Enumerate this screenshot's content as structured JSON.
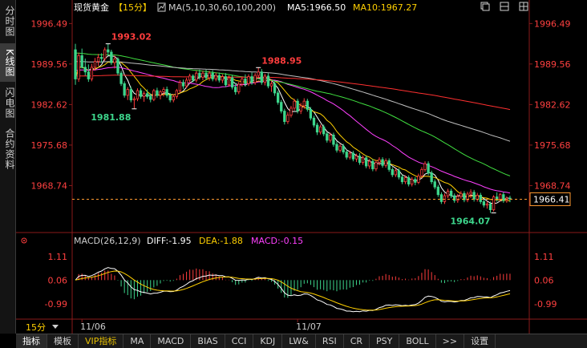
{
  "sidebar": {
    "tabs": [
      {
        "label": "分时图",
        "active": false
      },
      {
        "label": "K线图",
        "active": true
      },
      {
        "label": "闪电图",
        "active": false
      },
      {
        "label": "合约资料",
        "active": false
      }
    ]
  },
  "header": {
    "title": "现货黄金",
    "period": "【15分】",
    "ma_label": "MA(5,10,30,60,100,200)",
    "ma5": "MA5:1966.50",
    "ma10": "MA10:1967.27"
  },
  "macd_header": {
    "label": "MACD(26,12,9)",
    "diff": "DIFF:-1.95",
    "dea": "DEA:-1.88",
    "macd": "MACD:-0.15"
  },
  "period_select": "15分",
  "bottom_tabs": [
    {
      "label": "指标",
      "active": true,
      "vip": false
    },
    {
      "label": "模板",
      "active": false,
      "vip": false
    },
    {
      "label": "VIP指标",
      "active": false,
      "vip": true
    },
    {
      "label": "MA",
      "active": false,
      "vip": false
    },
    {
      "label": "MACD",
      "active": false,
      "vip": false
    },
    {
      "label": "BIAS",
      "active": false,
      "vip": false
    },
    {
      "label": "CCI",
      "active": false,
      "vip": false
    },
    {
      "label": "KDJ",
      "active": false,
      "vip": false
    },
    {
      "label": "LW&",
      "active": false,
      "vip": false
    },
    {
      "label": "RSI",
      "active": false,
      "vip": false
    },
    {
      "label": "CR",
      "active": false,
      "vip": false
    },
    {
      "label": "PSY",
      "active": false,
      "vip": false
    },
    {
      "label": "BOLL",
      "active": false,
      "vip": false
    },
    {
      "label": ">>",
      "active": false,
      "vip": false
    },
    {
      "label": "设置",
      "active": false,
      "vip": false
    }
  ],
  "colors": {
    "up": "#ff3d3d",
    "down": "#3dd68c",
    "ma5": "#ffffff",
    "ma10": "#ffd000",
    "ma30": "#ff40ff",
    "ma60": "#40e040",
    "ma100": "#c0c0c0",
    "ma200": "#ff3030",
    "diff": "#ffffff",
    "dea": "#ffd000",
    "last_line": "#ff9a30",
    "axis_label": "#ff4040"
  },
  "chart_data": {
    "type": "candlestick",
    "price_axis": {
      "ylim": [
        1964.0,
        1997.5
      ],
      "ticks": [
        1996.49,
        1989.56,
        1982.62,
        1975.68,
        1968.74
      ]
    },
    "macd_axis": {
      "ylim": [
        -1.6,
        1.6
      ],
      "ticks": [
        1.11,
        0.06,
        -0.99
      ]
    },
    "x_labels": [
      {
        "index": 2,
        "label": "11/06"
      },
      {
        "index": 68,
        "label": "11/07"
      }
    ],
    "annotations": [
      {
        "index": 10,
        "value": 1993.02,
        "label": "1993.02",
        "kind": "high"
      },
      {
        "index": 18,
        "value": 1981.88,
        "label": "1981.88",
        "kind": "low"
      },
      {
        "index": 56,
        "value": 1988.95,
        "label": "1988.95",
        "kind": "high"
      },
      {
        "index": 128,
        "value": 1964.07,
        "label": "1964.07",
        "kind": "low"
      }
    ],
    "last_price": 1966.41,
    "candles": [
      [
        1992.0,
        1993.02,
        1986.0,
        1987.0
      ],
      [
        1987.0,
        1991.5,
        1986.5,
        1991.0
      ],
      [
        1991.0,
        1992.2,
        1988.8,
        1989.0
      ],
      [
        1989.0,
        1990.5,
        1987.6,
        1988.2
      ],
      [
        1988.2,
        1989.5,
        1986.5,
        1987.0
      ],
      [
        1987.0,
        1989.6,
        1986.6,
        1989.0
      ],
      [
        1989.0,
        1990.6,
        1988.4,
        1990.0
      ],
      [
        1990.0,
        1991.3,
        1989.2,
        1990.7
      ],
      [
        1990.7,
        1991.4,
        1989.8,
        1990.5
      ],
      [
        1990.5,
        1992.4,
        1990.1,
        1992.0
      ],
      [
        1992.0,
        1993.02,
        1991.0,
        1991.6
      ],
      [
        1991.6,
        1992.0,
        1989.4,
        1989.8
      ],
      [
        1989.8,
        1991.0,
        1988.8,
        1990.4
      ],
      [
        1990.4,
        1990.7,
        1987.6,
        1988.0
      ],
      [
        1988.0,
        1988.4,
        1985.8,
        1986.2
      ],
      [
        1986.2,
        1986.6,
        1983.8,
        1984.2
      ],
      [
        1984.2,
        1985.6,
        1983.4,
        1985.2
      ],
      [
        1985.2,
        1985.7,
        1983.0,
        1983.4
      ],
      [
        1983.4,
        1984.0,
        1981.88,
        1983.6
      ],
      [
        1983.6,
        1985.4,
        1983.2,
        1985.0
      ],
      [
        1985.0,
        1985.4,
        1983.6,
        1984.0
      ],
      [
        1984.0,
        1984.9,
        1983.1,
        1984.5
      ],
      [
        1984.5,
        1985.2,
        1983.6,
        1984.0
      ],
      [
        1984.0,
        1984.5,
        1983.0,
        1983.5
      ],
      [
        1983.5,
        1985.3,
        1983.2,
        1985.0
      ],
      [
        1985.0,
        1985.5,
        1983.8,
        1984.2
      ],
      [
        1984.2,
        1985.1,
        1983.5,
        1984.8
      ],
      [
        1984.8,
        1985.6,
        1984.0,
        1985.2
      ],
      [
        1985.2,
        1985.7,
        1983.8,
        1984.2
      ],
      [
        1984.2,
        1984.6,
        1983.0,
        1983.4
      ],
      [
        1983.4,
        1984.4,
        1983.0,
        1984.0
      ],
      [
        1984.0,
        1985.3,
        1983.6,
        1985.0
      ],
      [
        1985.0,
        1986.8,
        1984.7,
        1986.4
      ],
      [
        1986.4,
        1986.9,
        1985.3,
        1985.8
      ],
      [
        1985.8,
        1987.2,
        1985.4,
        1986.8
      ],
      [
        1986.8,
        1987.9,
        1986.3,
        1987.5
      ],
      [
        1987.5,
        1987.8,
        1986.4,
        1986.8
      ],
      [
        1986.8,
        1988.4,
        1986.4,
        1988.0
      ],
      [
        1988.0,
        1988.6,
        1986.9,
        1987.3
      ],
      [
        1987.3,
        1988.4,
        1986.8,
        1988.0
      ],
      [
        1988.0,
        1988.6,
        1986.8,
        1987.2
      ],
      [
        1987.2,
        1988.4,
        1986.7,
        1988.0
      ],
      [
        1988.0,
        1988.5,
        1986.6,
        1987.0
      ],
      [
        1987.0,
        1988.1,
        1986.6,
        1987.6
      ],
      [
        1987.6,
        1988.1,
        1986.4,
        1986.8
      ],
      [
        1986.8,
        1987.8,
        1986.3,
        1987.4
      ],
      [
        1987.4,
        1988.0,
        1985.6,
        1986.0
      ],
      [
        1986.0,
        1987.6,
        1985.7,
        1987.2
      ],
      [
        1987.2,
        1987.7,
        1985.2,
        1985.6
      ],
      [
        1985.6,
        1986.3,
        1984.3,
        1984.8
      ],
      [
        1984.8,
        1986.5,
        1984.4,
        1986.1
      ],
      [
        1986.1,
        1987.4,
        1985.7,
        1987.0
      ],
      [
        1987.0,
        1987.8,
        1985.7,
        1986.2
      ],
      [
        1986.2,
        1987.8,
        1985.8,
        1987.4
      ],
      [
        1987.4,
        1988.1,
        1986.0,
        1986.4
      ],
      [
        1986.4,
        1988.0,
        1986.0,
        1987.6
      ],
      [
        1987.6,
        1988.95,
        1987.0,
        1988.2
      ],
      [
        1988.2,
        1988.7,
        1986.0,
        1986.4
      ],
      [
        1986.4,
        1987.9,
        1985.9,
        1987.5
      ],
      [
        1987.5,
        1988.0,
        1985.4,
        1985.8
      ],
      [
        1985.8,
        1986.7,
        1984.8,
        1986.2
      ],
      [
        1986.2,
        1986.6,
        1984.1,
        1984.6
      ],
      [
        1984.6,
        1985.0,
        1982.6,
        1983.0
      ],
      [
        1983.0,
        1983.4,
        1981.1,
        1981.5
      ],
      [
        1981.5,
        1981.9,
        1979.2,
        1979.7
      ],
      [
        1979.7,
        1981.3,
        1979.3,
        1980.8
      ],
      [
        1980.8,
        1982.4,
        1980.4,
        1982.0
      ],
      [
        1982.0,
        1983.6,
        1981.6,
        1983.2
      ],
      [
        1983.2,
        1983.6,
        1981.1,
        1981.5
      ],
      [
        1981.5,
        1982.9,
        1981.0,
        1982.4
      ],
      [
        1982.4,
        1983.7,
        1981.9,
        1983.2
      ],
      [
        1983.2,
        1983.6,
        1981.4,
        1981.8
      ],
      [
        1981.8,
        1982.2,
        1979.9,
        1980.3
      ],
      [
        1980.3,
        1980.7,
        1978.7,
        1979.1
      ],
      [
        1979.1,
        1979.5,
        1977.4,
        1977.9
      ],
      [
        1977.9,
        1979.2,
        1977.5,
        1978.8
      ],
      [
        1978.8,
        1979.2,
        1977.2,
        1977.6
      ],
      [
        1977.6,
        1977.9,
        1976.1,
        1976.5
      ],
      [
        1976.5,
        1977.8,
        1976.1,
        1977.4
      ],
      [
        1977.4,
        1977.8,
        1975.4,
        1975.8
      ],
      [
        1975.8,
        1976.3,
        1974.4,
        1974.8
      ],
      [
        1974.8,
        1975.9,
        1974.4,
        1975.5
      ],
      [
        1975.5,
        1975.9,
        1974.1,
        1974.5
      ],
      [
        1974.5,
        1974.9,
        1973.2,
        1973.6
      ],
      [
        1973.6,
        1974.7,
        1973.2,
        1974.3
      ],
      [
        1974.3,
        1974.7,
        1972.9,
        1973.3
      ],
      [
        1973.3,
        1974.2,
        1972.8,
        1973.8
      ],
      [
        1973.8,
        1974.3,
        1972.3,
        1972.7
      ],
      [
        1972.7,
        1973.9,
        1972.3,
        1973.5
      ],
      [
        1973.5,
        1973.9,
        1971.7,
        1972.1
      ],
      [
        1972.1,
        1973.3,
        1971.6,
        1972.9
      ],
      [
        1972.9,
        1973.3,
        1971.2,
        1971.6
      ],
      [
        1971.6,
        1973.1,
        1971.2,
        1972.7
      ],
      [
        1972.7,
        1973.6,
        1972.2,
        1973.2
      ],
      [
        1973.2,
        1973.6,
        1971.8,
        1972.2
      ],
      [
        1972.2,
        1973.4,
        1971.8,
        1973.0
      ],
      [
        1973.0,
        1973.4,
        1971.1,
        1971.5
      ],
      [
        1971.5,
        1971.9,
        1970.2,
        1970.6
      ],
      [
        1970.6,
        1971.7,
        1970.2,
        1971.3
      ],
      [
        1971.3,
        1971.7,
        1969.8,
        1970.2
      ],
      [
        1970.2,
        1970.6,
        1969.0,
        1969.4
      ],
      [
        1969.4,
        1970.5,
        1969.0,
        1970.1
      ],
      [
        1970.1,
        1970.5,
        1968.6,
        1969.0
      ],
      [
        1969.0,
        1970.2,
        1968.6,
        1969.8
      ],
      [
        1969.8,
        1970.2,
        1968.8,
        1969.3
      ],
      [
        1969.3,
        1970.8,
        1969.0,
        1970.4
      ],
      [
        1970.4,
        1971.9,
        1970.0,
        1971.5
      ],
      [
        1971.5,
        1972.9,
        1971.1,
        1972.5
      ],
      [
        1972.5,
        1972.9,
        1970.5,
        1970.9
      ],
      [
        1970.9,
        1971.3,
        1969.0,
        1969.4
      ],
      [
        1969.4,
        1969.8,
        1968.1,
        1968.5
      ],
      [
        1968.5,
        1968.9,
        1966.8,
        1967.2
      ],
      [
        1967.2,
        1967.6,
        1965.6,
        1966.0
      ],
      [
        1966.0,
        1967.4,
        1965.6,
        1967.0
      ],
      [
        1967.0,
        1968.2,
        1966.6,
        1967.8
      ],
      [
        1967.8,
        1968.2,
        1966.6,
        1967.0
      ],
      [
        1967.0,
        1967.4,
        1965.8,
        1966.2
      ],
      [
        1966.2,
        1967.3,
        1965.8,
        1966.9
      ],
      [
        1966.9,
        1967.8,
        1966.5,
        1967.4
      ],
      [
        1967.4,
        1967.8,
        1965.9,
        1966.3
      ],
      [
        1966.3,
        1967.7,
        1965.9,
        1967.3
      ],
      [
        1967.3,
        1968.1,
        1966.6,
        1967.6
      ],
      [
        1967.6,
        1968.0,
        1966.0,
        1966.4
      ],
      [
        1966.4,
        1967.5,
        1966.0,
        1967.1
      ],
      [
        1967.1,
        1967.5,
        1965.6,
        1966.0
      ],
      [
        1966.0,
        1966.4,
        1965.0,
        1965.4
      ],
      [
        1965.4,
        1966.1,
        1964.8,
        1965.6
      ],
      [
        1965.6,
        1966.0,
        1964.07,
        1964.6
      ],
      [
        1964.6,
        1967.1,
        1964.3,
        1966.8
      ],
      [
        1966.8,
        1967.6,
        1966.0,
        1966.4
      ],
      [
        1966.4,
        1967.5,
        1966.0,
        1967.2
      ],
      [
        1967.2,
        1967.6,
        1965.8,
        1966.2
      ],
      [
        1966.2,
        1966.9,
        1965.8,
        1966.6
      ],
      [
        1966.6,
        1967.0,
        1965.9,
        1966.41
      ]
    ]
  }
}
